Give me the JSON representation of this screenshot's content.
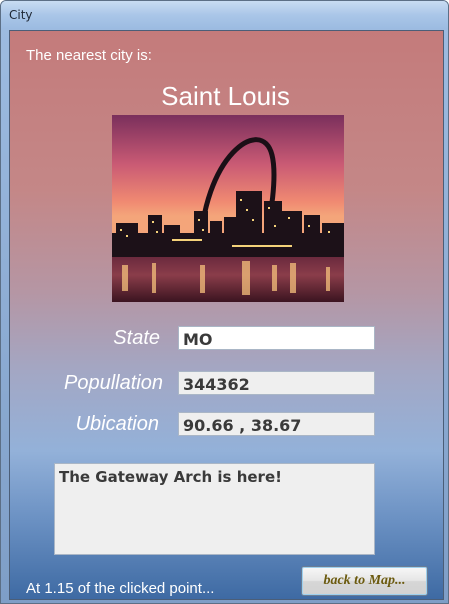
{
  "window": {
    "title": "City"
  },
  "content": {
    "intro_text": "The nearest city is:",
    "city_name": "Saint Louis",
    "photo_icon": "city-skyline-photo"
  },
  "fields": {
    "state_label": "State",
    "state_value": "MO",
    "population_label": "Popullation",
    "population_value": "344362",
    "location_label": "Ubication",
    "location_value": "90.66 , 38.67"
  },
  "description": "The Gateway Arch is here!",
  "footer": {
    "distance_text": "At 1.15 of the clicked point...",
    "back_button_label": "back to Map..."
  },
  "colors": {
    "text_white": "#ffffff",
    "button_text": "#6b5a0e"
  }
}
